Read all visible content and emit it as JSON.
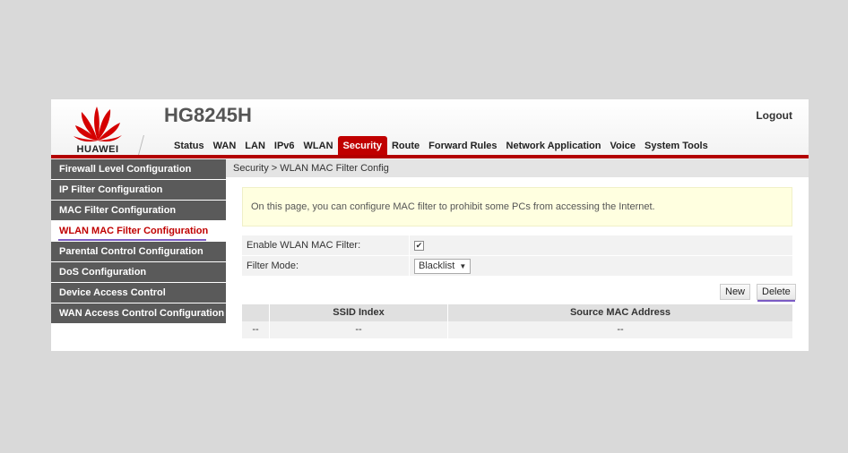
{
  "header": {
    "brand": "HUAWEI",
    "model": "HG8245H",
    "logout_label": "Logout",
    "brand_color": "#c00000"
  },
  "nav": {
    "items": [
      "Status",
      "WAN",
      "LAN",
      "IPv6",
      "WLAN",
      "Security",
      "Route",
      "Forward Rules",
      "Network Application",
      "Voice",
      "System Tools"
    ],
    "active": "Security"
  },
  "sidebar": {
    "items": [
      "Firewall Level Configuration",
      "IP Filter Configuration",
      "MAC Filter Configuration",
      "WLAN MAC Filter Configuration",
      "Parental Control Configuration",
      "DoS Configuration",
      "Device Access Control",
      "WAN Access Control Configuration"
    ],
    "active": "WLAN MAC Filter Configuration"
  },
  "breadcrumb": "Security > WLAN MAC Filter Config",
  "notice": "On this page, you can configure MAC filter to prohibit some PCs from accessing the Internet.",
  "form": {
    "enable_label": "Enable WLAN MAC Filter:",
    "enable_checked": true,
    "check_glyph": "✔",
    "mode_label": "Filter Mode:",
    "mode_value": "Blacklist",
    "mode_arrow": "▼"
  },
  "buttons": {
    "new_label": "New",
    "delete_label": "Delete"
  },
  "table": {
    "headers": [
      "",
      "SSID Index",
      "Source MAC Address"
    ],
    "rows": [
      [
        "--",
        "--",
        "--"
      ]
    ]
  }
}
